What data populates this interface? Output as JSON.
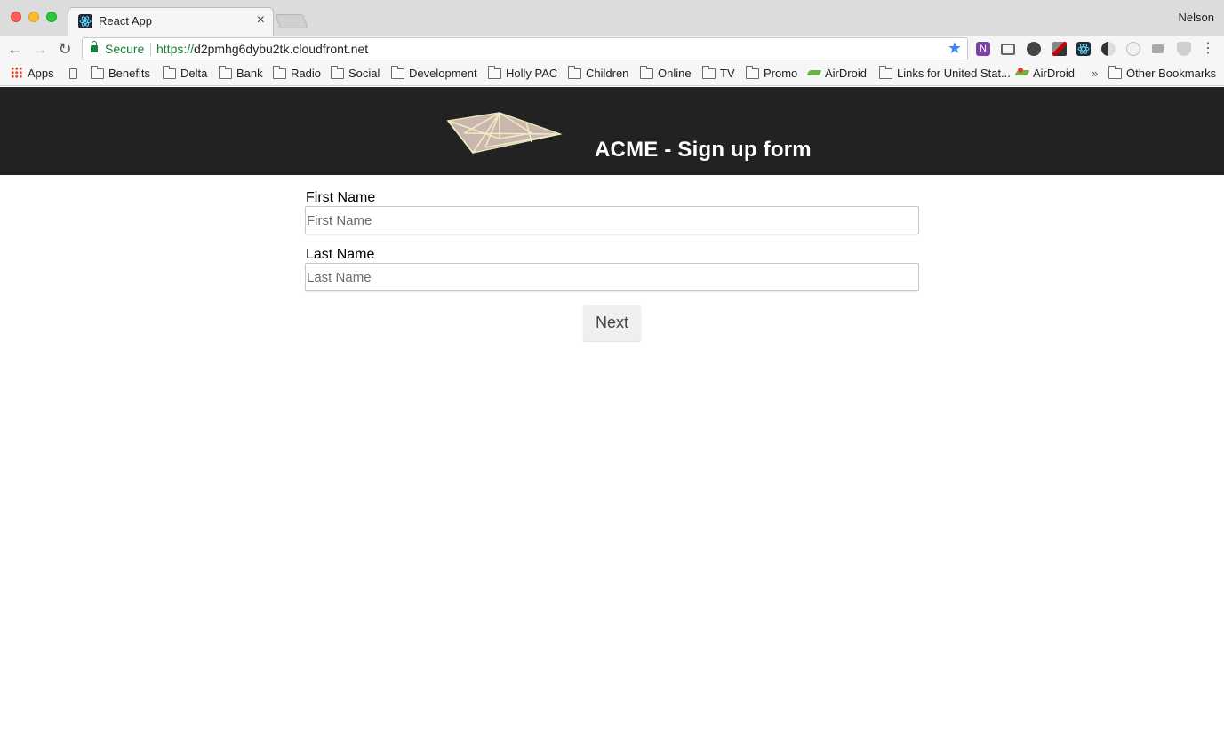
{
  "browser": {
    "tab_title": "React App",
    "tab_close": "×",
    "profile_name": "Nelson",
    "address": {
      "security_label": "Secure",
      "url_scheme": "https://",
      "url_host": "d2pmhg6dybu2tk.cloudfront.net"
    },
    "nav": {
      "back": "←",
      "forward": "→",
      "reload": "↻",
      "menu": "⋮",
      "star": "★"
    },
    "extensions": [
      "onenote-icon",
      "cast-icon",
      "evernote-icon",
      "eyedropper-icon",
      "react-devtools-icon",
      "contrast-icon",
      "extension-icon",
      "camera-icon",
      "shield-icon"
    ],
    "bookmarks": {
      "apps": "Apps",
      "items": [
        "Benefits",
        "Delta",
        "Bank",
        "Radio",
        "Social",
        "Development",
        "Holly PAC",
        "Children",
        "Online",
        "TV",
        "Promo",
        "AirDroid",
        "Links for United Stat...",
        "AirDroid"
      ],
      "overflow": "»",
      "other": "Other Bookmarks"
    }
  },
  "page": {
    "title": "ACME - Sign up form",
    "form": {
      "first_name": {
        "label": "First Name",
        "placeholder": "First Name",
        "value": ""
      },
      "last_name": {
        "label": "Last Name",
        "placeholder": "Last Name",
        "value": ""
      },
      "next_label": "Next"
    }
  }
}
